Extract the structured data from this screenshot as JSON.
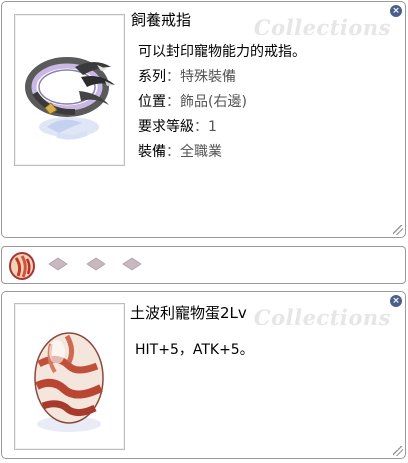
{
  "item1": {
    "name": "飼養戒指",
    "bg_text": "Collections",
    "description": "可以封印寵物能力的戒指。",
    "rows": [
      {
        "key": "系列",
        "sep": "：",
        "value": "特殊裝備"
      },
      {
        "key": "位置",
        "sep": "：",
        "value": "飾品(右邊)"
      },
      {
        "key": "要求等級",
        "sep": "：",
        "value": "1"
      },
      {
        "key": "裝備",
        "sep": "：",
        "value": "全職業"
      }
    ],
    "icon": "ring-icon"
  },
  "slots": {
    "count": 3,
    "card_icon": "card-slot-icon"
  },
  "item2": {
    "name": "土波利寵物蛋2Lv",
    "bg_text": "Collections",
    "description": "HIT+5，ATK+5。",
    "icon": "egg-icon"
  },
  "colors": {
    "close_button": "#4a5f8d",
    "border": "#9a9a9a",
    "slot_diamond": "#c9b8c0"
  }
}
